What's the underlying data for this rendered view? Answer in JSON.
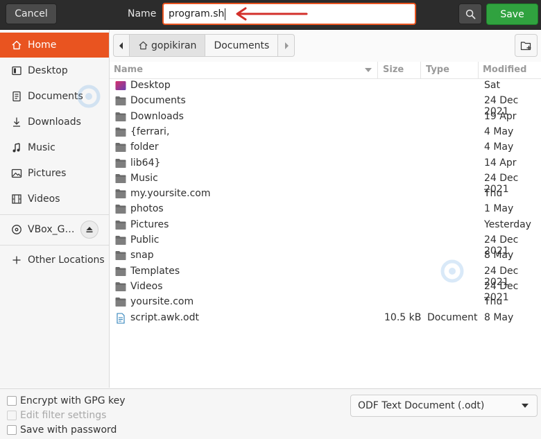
{
  "header": {
    "cancel_label": "Cancel",
    "name_label": "Name",
    "name_value": "program.sh",
    "save_label": "Save",
    "search_icon": "search-icon"
  },
  "sidebar": {
    "items": [
      {
        "label": "Home",
        "icon": "home-icon",
        "active": true
      },
      {
        "label": "Desktop",
        "icon": "desktop-icon"
      },
      {
        "label": "Documents",
        "icon": "documents-icon"
      },
      {
        "label": "Downloads",
        "icon": "download-icon"
      },
      {
        "label": "Music",
        "icon": "music-icon"
      },
      {
        "label": "Pictures",
        "icon": "pictures-icon"
      },
      {
        "label": "Videos",
        "icon": "videos-icon"
      },
      {
        "label": "VBox_G…",
        "icon": "disc-icon"
      },
      {
        "label": "Other Locations",
        "icon": "plus-icon"
      }
    ]
  },
  "pathbar": {
    "segments": [
      "gopikiran",
      "Documents"
    ]
  },
  "columns": {
    "name": "Name",
    "size": "Size",
    "type": "Type",
    "modified": "Modified"
  },
  "files": [
    {
      "name": "Desktop",
      "size": "",
      "type": "",
      "modified": "Sat",
      "kind": "desktop-folder"
    },
    {
      "name": "Documents",
      "size": "",
      "type": "",
      "modified": "24 Dec 2021",
      "kind": "folder"
    },
    {
      "name": "Downloads",
      "size": "",
      "type": "",
      "modified": "19 Apr",
      "kind": "folder"
    },
    {
      "name": "{ferrari,",
      "size": "",
      "type": "",
      "modified": "4 May",
      "kind": "folder"
    },
    {
      "name": "folder",
      "size": "",
      "type": "",
      "modified": "4 May",
      "kind": "folder"
    },
    {
      "name": "lib64}",
      "size": "",
      "type": "",
      "modified": "14 Apr",
      "kind": "folder"
    },
    {
      "name": "Music",
      "size": "",
      "type": "",
      "modified": "24 Dec 2021",
      "kind": "folder"
    },
    {
      "name": "my.yoursite.com",
      "size": "",
      "type": "",
      "modified": "Thu",
      "kind": "folder"
    },
    {
      "name": "photos",
      "size": "",
      "type": "",
      "modified": "1 May",
      "kind": "folder"
    },
    {
      "name": "Pictures",
      "size": "",
      "type": "",
      "modified": "Yesterday",
      "kind": "folder"
    },
    {
      "name": "Public",
      "size": "",
      "type": "",
      "modified": "24 Dec 2021",
      "kind": "folder"
    },
    {
      "name": "snap",
      "size": "",
      "type": "",
      "modified": "8 May",
      "kind": "folder"
    },
    {
      "name": "Templates",
      "size": "",
      "type": "",
      "modified": "24 Dec 2021",
      "kind": "folder"
    },
    {
      "name": "Videos",
      "size": "",
      "type": "",
      "modified": "24 Dec 2021",
      "kind": "folder"
    },
    {
      "name": "yoursite.com",
      "size": "",
      "type": "",
      "modified": "Thu",
      "kind": "folder"
    },
    {
      "name": "script.awk.odt",
      "size": "10.5 kB",
      "type": "Document",
      "modified": "8 May",
      "kind": "document"
    }
  ],
  "options": {
    "encrypt_label": "Encrypt with GPG key",
    "filter_settings_label": "Edit filter settings",
    "save_password_label": "Save with password"
  },
  "filter": {
    "selected": "ODF Text Document (.odt)"
  },
  "colors": {
    "accent": "#e95420",
    "save_green": "#30a23f",
    "header_bg": "#2c2c2c",
    "annotation_arrow": "#d3302b"
  }
}
